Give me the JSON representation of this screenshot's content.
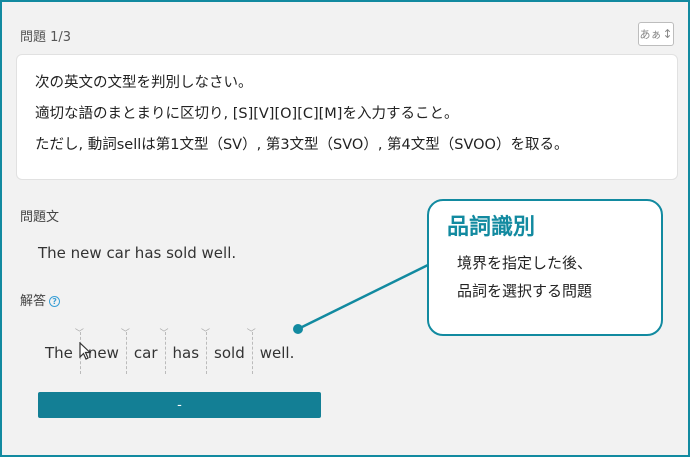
{
  "question": {
    "number": "問題 1/3",
    "font_toggle": {
      "label": "あぁ",
      "icon": "resize-vertical-arrow-icon"
    }
  },
  "instructions": {
    "lines": [
      "次の英文の文型を判別しなさい。",
      "適切な語のまとまりに区切り, [S][V][O][C][M]を入力すること。",
      "ただし, 動詞sellは第1文型（SV）, 第3文型（SVO）, 第4文型（SVOO）を取る。"
    ]
  },
  "problem": {
    "label": "問題文",
    "sentence": "The new car has sold well."
  },
  "answer": {
    "label": "解答",
    "help_icon": "question-circle-icon",
    "words": [
      "The",
      "new",
      "car",
      "has",
      "sold",
      "well."
    ],
    "submit_label": "-"
  },
  "callout": {
    "title": "品詞識別",
    "lines": [
      "境界を指定した後、",
      "品詞を選択する問題"
    ]
  },
  "colors": {
    "accent": "#128aa0",
    "button": "#137f95",
    "help": "#3a9fd6"
  }
}
